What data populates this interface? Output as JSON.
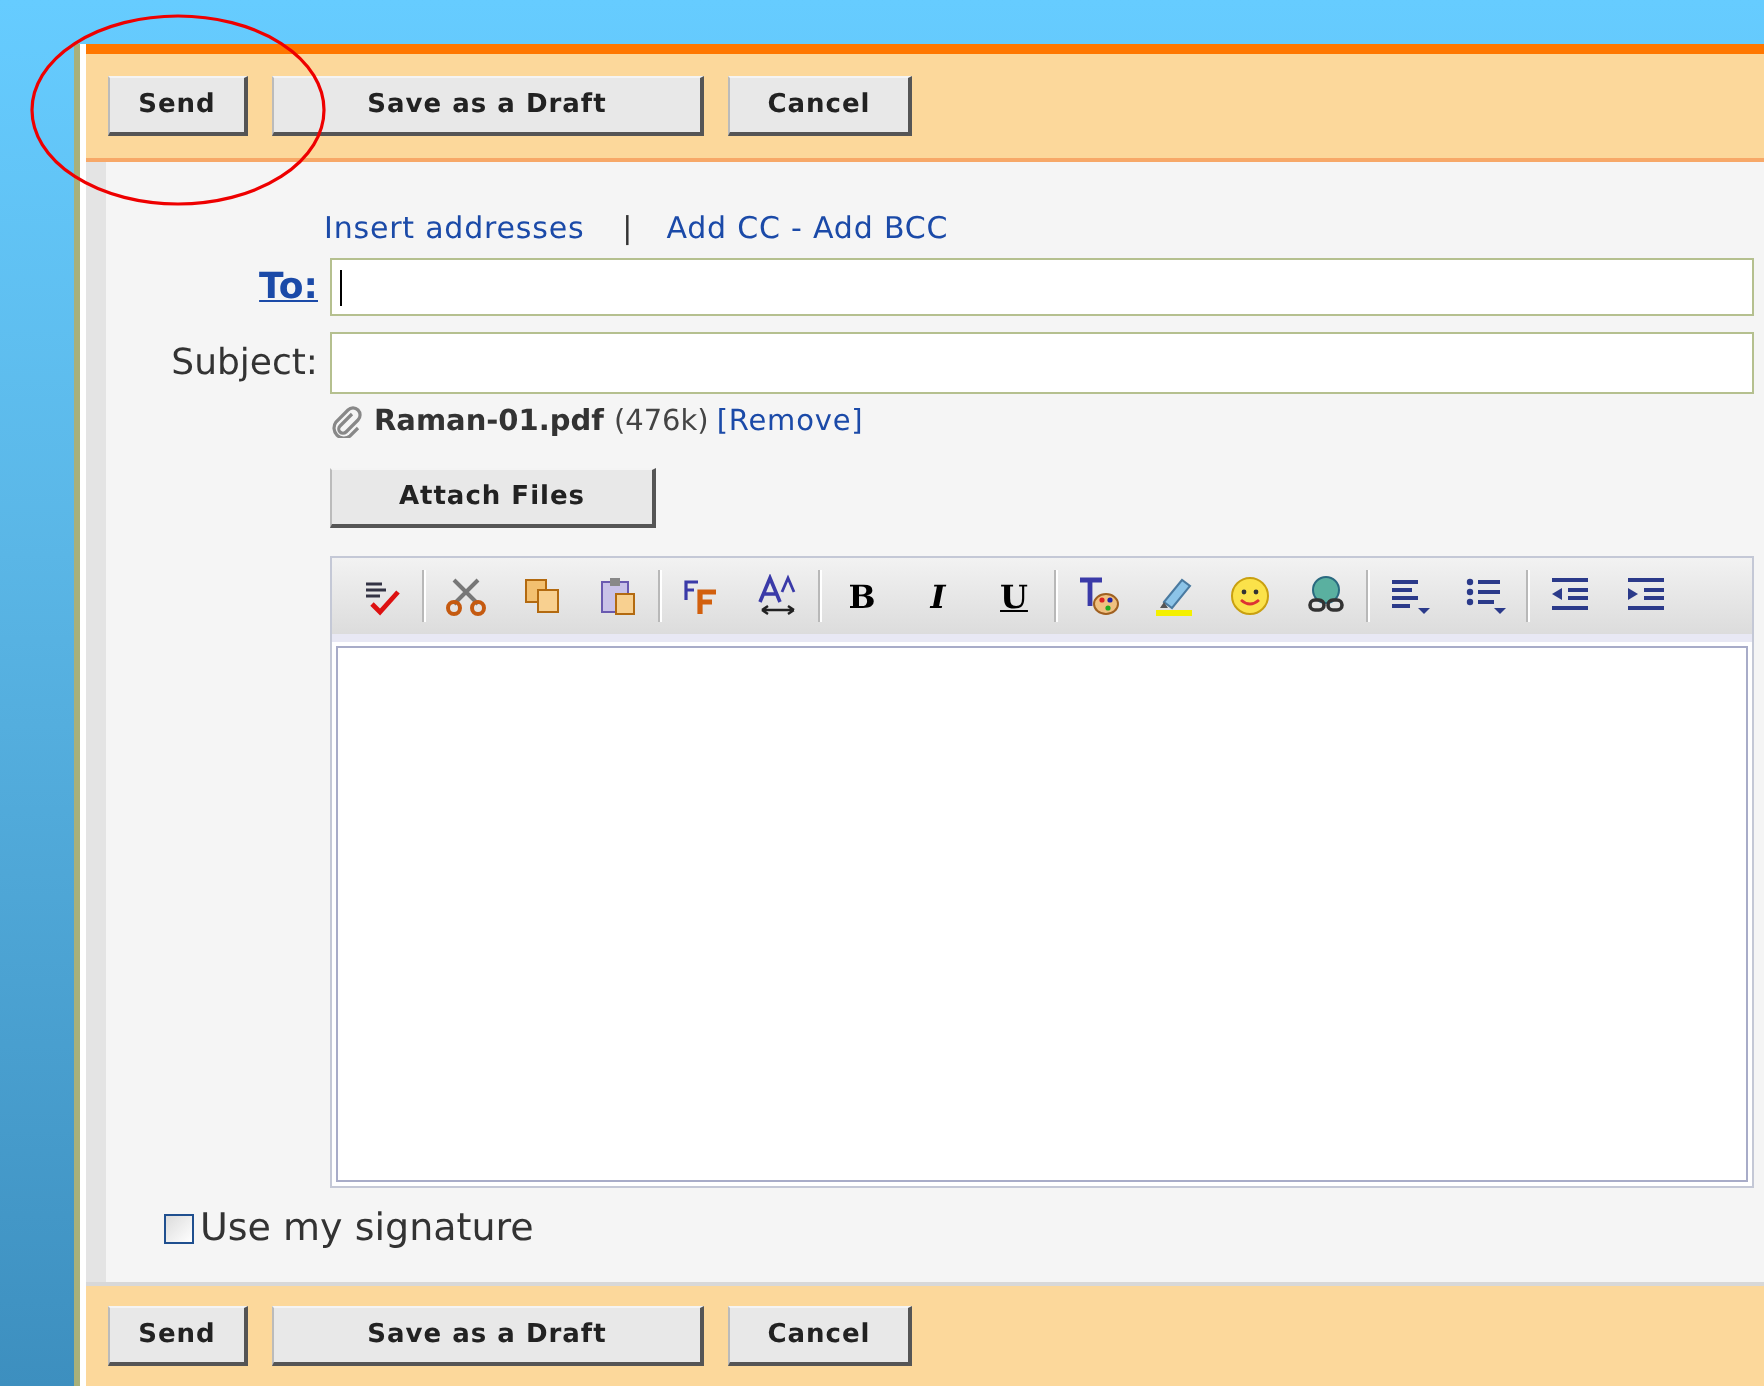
{
  "top_toolbar": {
    "buttons": [
      "Send",
      "Save as a Draft",
      "Cancel"
    ]
  },
  "address_links": {
    "insert": "Insert addresses",
    "separator": "|",
    "cc_bcc": "Add CC - Add BCC"
  },
  "to": {
    "label": "To:",
    "focused": true
  },
  "subject": {
    "label": "Subject:"
  },
  "attachment": {
    "file_name": "Raman-01.pdf",
    "size": "(476k)",
    "remove_link": "[Remove]"
  },
  "attach_button": "Attach Files",
  "editor_toolbar": {
    "groups": [
      {
        "tools": [
          {
            "kind": "spellcheck"
          }
        ]
      },
      {
        "tools": [
          {
            "kind": "cut"
          },
          {
            "kind": "copy"
          },
          {
            "kind": "paste"
          }
        ]
      },
      {
        "tools": [
          {
            "kind": "font"
          },
          {
            "kind": "font-size"
          }
        ]
      },
      {
        "tools": [
          {
            "kind": "bold",
            "label": "B"
          },
          {
            "kind": "italic",
            "label": "I"
          },
          {
            "kind": "underline",
            "label": "U"
          }
        ]
      },
      {
        "tools": [
          {
            "kind": "text-color"
          },
          {
            "kind": "highlight"
          },
          {
            "kind": "smiley"
          },
          {
            "kind": "link"
          }
        ]
      },
      {
        "tools": [
          {
            "kind": "align"
          },
          {
            "kind": "list"
          }
        ]
      },
      {
        "tools": [
          {
            "kind": "outdent"
          },
          {
            "kind": "indent"
          }
        ]
      }
    ]
  },
  "signature": {
    "label": "Use my signature",
    "checked": false
  },
  "bottom_toolbar": {
    "buttons": [
      "Send",
      "Save as a Draft",
      "Cancel"
    ]
  }
}
